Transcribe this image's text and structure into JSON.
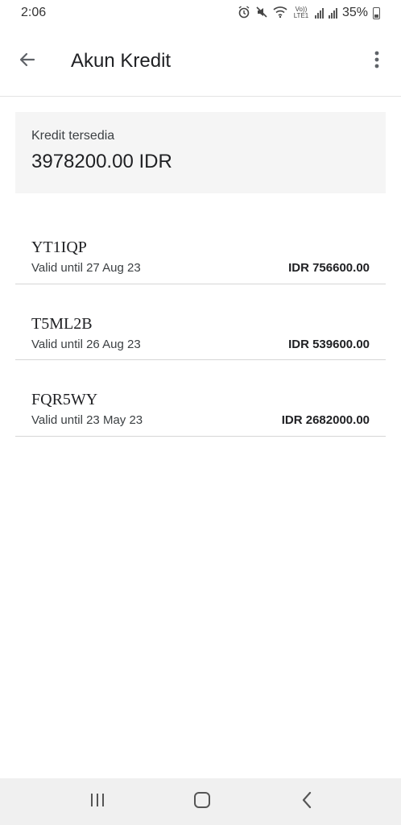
{
  "status_bar": {
    "time": "2:06",
    "network_label": "Vo)) LTE1",
    "battery": "35%"
  },
  "app_bar": {
    "title": "Akun Kredit",
    "back_icon": "arrow-back-icon",
    "menu_icon": "more-vert-icon"
  },
  "credit": {
    "label": "Kredit tersedia",
    "value": "3978200.00 IDR"
  },
  "vouchers": [
    {
      "code": "YT1IQP",
      "valid": "Valid until 27 Aug 23",
      "amount": "IDR 756600.00"
    },
    {
      "code": "T5ML2B",
      "valid": "Valid until 26 Aug 23",
      "amount": "IDR 539600.00"
    },
    {
      "code": "FQR5WY",
      "valid": "Valid until 23 May 23",
      "amount": "IDR 2682000.00"
    }
  ],
  "nav_bar": {
    "recents_icon": "recents-icon",
    "home_icon": "home-icon",
    "back_icon": "nav-back-icon"
  },
  "colors": {
    "card_background": "#f5f5f5",
    "nav_background": "#f0f0f0",
    "divider": "#d6d6d6"
  }
}
